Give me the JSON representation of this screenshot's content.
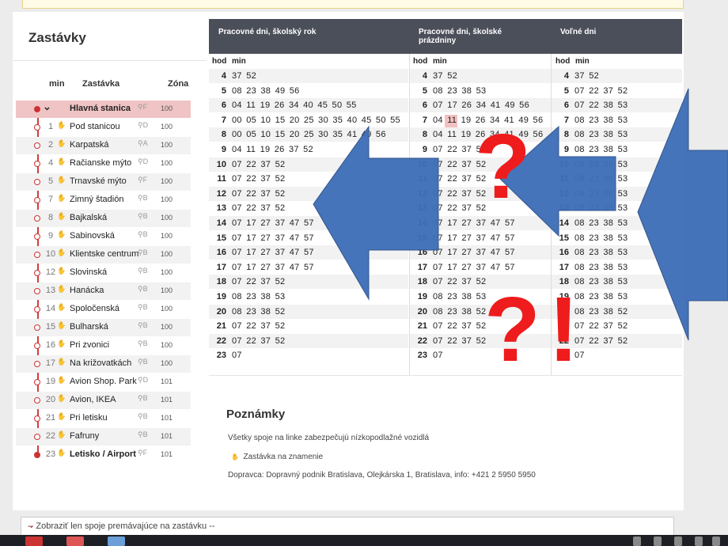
{
  "stops": {
    "title": "Zastávky",
    "col_min": "min",
    "col_stop": "Zastávka",
    "col_zone": "Zóna",
    "items": [
      {
        "min": "",
        "name": "Hlavná stanica",
        "zone_letter": "F",
        "zone": "100",
        "bold": true,
        "selected": true
      },
      {
        "min": "1",
        "name": "Pod stanicou",
        "zone_letter": "D",
        "zone": "100"
      },
      {
        "min": "2",
        "name": "Karpatská",
        "zone_letter": "A",
        "zone": "100"
      },
      {
        "min": "4",
        "name": "Račianske mýto",
        "zone_letter": "D",
        "zone": "100"
      },
      {
        "min": "5",
        "name": "Trnavské mýto",
        "zone_letter": "F",
        "zone": "100"
      },
      {
        "min": "7",
        "name": "Zimný štadión",
        "zone_letter": "B",
        "zone": "100"
      },
      {
        "min": "8",
        "name": "Bajkalská",
        "zone_letter": "B",
        "zone": "100"
      },
      {
        "min": "9",
        "name": "Sabinovská",
        "zone_letter": "B",
        "zone": "100"
      },
      {
        "min": "10",
        "name": "Klientske centrum",
        "zone_letter": "B",
        "zone": "100"
      },
      {
        "min": "12",
        "name": "Slovinská",
        "zone_letter": "B",
        "zone": "100"
      },
      {
        "min": "13",
        "name": "Hanácka",
        "zone_letter": "B",
        "zone": "100"
      },
      {
        "min": "14",
        "name": "Spoločenská",
        "zone_letter": "B",
        "zone": "100"
      },
      {
        "min": "15",
        "name": "Bulharská",
        "zone_letter": "B",
        "zone": "100"
      },
      {
        "min": "16",
        "name": "Pri zvonici",
        "zone_letter": "B",
        "zone": "100"
      },
      {
        "min": "17",
        "name": "Na križovatkách",
        "zone_letter": "B",
        "zone": "100"
      },
      {
        "min": "19",
        "name": "Avion Shop. Park",
        "zone_letter": "D",
        "zone": "101"
      },
      {
        "min": "20",
        "name": "Avion, IKEA",
        "zone_letter": "B",
        "zone": "101"
      },
      {
        "min": "21",
        "name": "Pri letisku",
        "zone_letter": "B",
        "zone": "101"
      },
      {
        "min": "22",
        "name": "Fafruny",
        "zone_letter": "B",
        "zone": "101"
      },
      {
        "min": "23",
        "name": "Letisko / Airport",
        "zone_letter": "F",
        "zone": "101",
        "bold": true
      }
    ]
  },
  "timetable": {
    "columns": [
      {
        "title_line1": "Pracovné dni, školský rok",
        "title_line2": "",
        "hod": "hod",
        "min": "min",
        "rows": [
          [
            "4",
            "37 52"
          ],
          [
            "5",
            "08 23 38 49 56"
          ],
          [
            "6",
            "04 11 19 26 34 40 45 50 55"
          ],
          [
            "7",
            "00 05 10 15 20 25 30 35 40 45 50 55"
          ],
          [
            "8",
            "00 05 10 15 20 25 30 35 41 49 56"
          ],
          [
            "9",
            "04 11 19 26 37 52"
          ],
          [
            "10",
            "07 22 37 52"
          ],
          [
            "11",
            "07 22 37 52"
          ],
          [
            "12",
            "07 22 37 52"
          ],
          [
            "13",
            "07 22 37 52"
          ],
          [
            "14",
            "07 17 27 37 47 57"
          ],
          [
            "15",
            "07 17 27 37 47 57"
          ],
          [
            "16",
            "07 17 27 37 47 57"
          ],
          [
            "17",
            "07 17 27 37 47 57"
          ],
          [
            "18",
            "07 22 37 52"
          ],
          [
            "19",
            "08 23 38 53"
          ],
          [
            "20",
            "08 23 38 52"
          ],
          [
            "21",
            "07 22 37 52"
          ],
          [
            "22",
            "07 22 37 52"
          ],
          [
            "23",
            "07"
          ]
        ]
      },
      {
        "title_line1": "Pracovné dni, školské",
        "title_line2": "prázdniny",
        "hod": "hod",
        "min": "min",
        "rows": [
          [
            "4",
            "37 52"
          ],
          [
            "5",
            "08 23 38 53"
          ],
          [
            "6",
            "07 17 26 34 41 49 56"
          ],
          [
            "7",
            "04 11 19 26 34 41 49 56"
          ],
          [
            "8",
            "04 11 19 26 34 41 49 56"
          ],
          [
            "9",
            "07 22 37 52"
          ],
          [
            "10",
            "07 22 37 52"
          ],
          [
            "11",
            "07 22 37 52"
          ],
          [
            "12",
            "07 22 37 52"
          ],
          [
            "13",
            "07 22 37 52"
          ],
          [
            "14",
            "07 17 27 37 47 57"
          ],
          [
            "15",
            "07 17 27 37 47 57"
          ],
          [
            "16",
            "07 17 27 37 47 57"
          ],
          [
            "17",
            "07 17 27 37 47 57"
          ],
          [
            "18",
            "07 22 37 52"
          ],
          [
            "19",
            "08 23 38 53"
          ],
          [
            "20",
            "08 23 38 52"
          ],
          [
            "21",
            "07 22 37 52"
          ],
          [
            "22",
            "07 22 37 52"
          ],
          [
            "23",
            "07"
          ]
        ]
      },
      {
        "title_line1": "Voľné dni",
        "title_line2": "",
        "hod": "hod",
        "min": "min",
        "rows": [
          [
            "4",
            "37 52"
          ],
          [
            "5",
            "07 22 37 52"
          ],
          [
            "6",
            "07 22 38 53"
          ],
          [
            "7",
            "08 23 38 53"
          ],
          [
            "8",
            "08 23 38 53"
          ],
          [
            "9",
            "08 23 38 53"
          ],
          [
            "10",
            "08 23 38 53"
          ],
          [
            "11",
            "08 23 38 53"
          ],
          [
            "12",
            "08 23 38 53"
          ],
          [
            "13",
            "08 23 38 53"
          ],
          [
            "14",
            "08 23 38 53"
          ],
          [
            "15",
            "08 23 38 53"
          ],
          [
            "16",
            "08 23 38 53"
          ],
          [
            "17",
            "08 23 38 53"
          ],
          [
            "18",
            "08 23 38 53"
          ],
          [
            "19",
            "08 23 38 53"
          ],
          [
            "20",
            "08 23 38 52"
          ],
          [
            "21",
            "07 22 37 52"
          ],
          [
            "22",
            "07 22 37 52"
          ],
          [
            "23",
            "07"
          ]
        ]
      }
    ]
  },
  "notes": {
    "title": "Poznámky",
    "line1": "Všetky spoje na linke zabezpečujú nízkopodlažné vozidlá",
    "line2": "Zastávka na znamenie",
    "line3": "Dopravca: Dopravný podnik Bratislava, Olejkárska 1, Bratislava, info: +421 2 5950 5950"
  },
  "filter": {
    "selected": "-- Zobraziť len spoje premávajúce na zastávku --"
  },
  "annotations": {
    "question_marks": [
      "?",
      "?!"
    ],
    "arrow_color": "#3f6fb8",
    "mark_color": "#ee1c1c"
  },
  "colors": {
    "accent": "#d23c3c",
    "header_bg": "#4b4f5a",
    "selected_row": "#f0c4c4"
  }
}
